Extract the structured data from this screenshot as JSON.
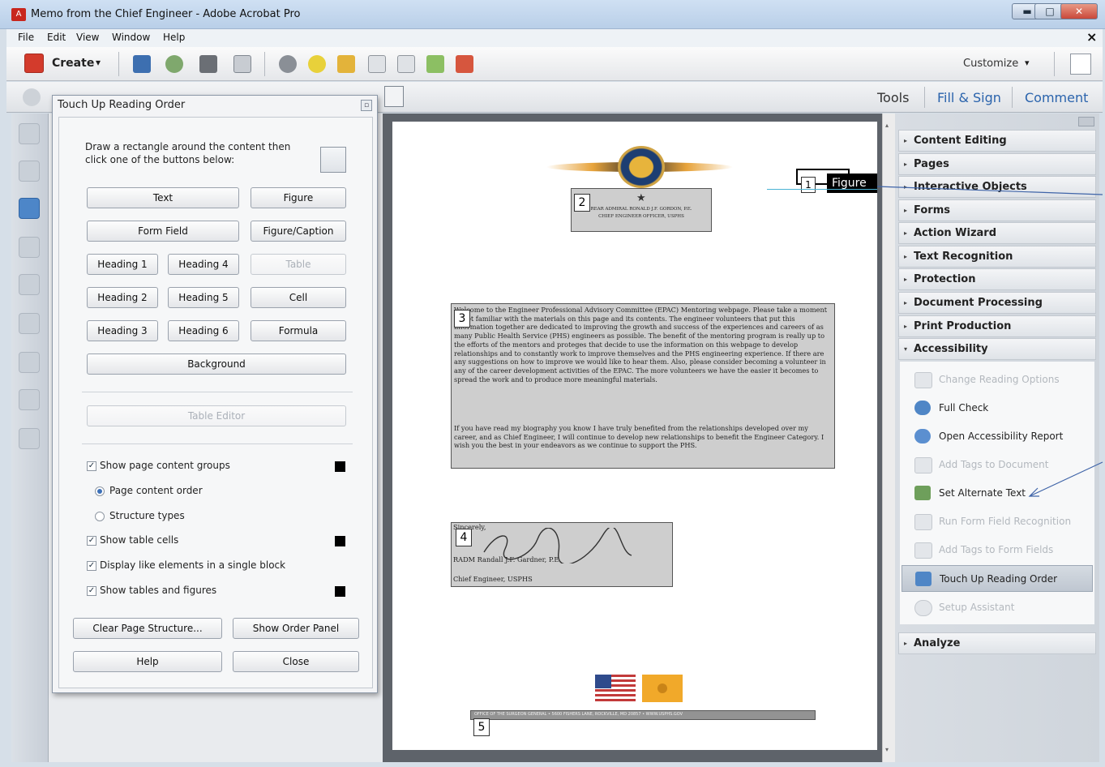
{
  "window": {
    "title": "Memo from the Chief Engineer - Adobe Acrobat Pro",
    "minimize": "▬",
    "maximize": "□",
    "close": "✕"
  },
  "menubar": {
    "items": [
      "File",
      "Edit",
      "View",
      "Window",
      "Help"
    ],
    "close_doc": "×"
  },
  "toolbar": {
    "create_label": "Create",
    "customize_label": "Customize",
    "dropdown_arrow": "▾"
  },
  "tabs": {
    "tools": "Tools",
    "fill_sign": "Fill & Sign",
    "comment": "Comment"
  },
  "dialog": {
    "title": "Touch Up Reading Order",
    "instructions": "Draw a rectangle around the content then click one of the buttons below:",
    "buttons": {
      "text": "Text",
      "figure": "Figure",
      "form_field": "Form Field",
      "figure_caption": "Figure/Caption",
      "heading1": "Heading 1",
      "heading4": "Heading 4",
      "table": "Table",
      "heading2": "Heading 2",
      "heading5": "Heading 5",
      "cell": "Cell",
      "heading3": "Heading 3",
      "heading6": "Heading 6",
      "formula": "Formula",
      "background": "Background",
      "table_editor": "Table Editor",
      "clear_page_structure": "Clear Page Structure...",
      "show_order_panel": "Show Order Panel",
      "help": "Help",
      "close": "Close"
    },
    "options": {
      "show_page_content_groups": "Show page content groups",
      "page_content_order": "Page content order",
      "structure_types": "Structure types",
      "show_table_cells": "Show table cells",
      "display_like_elements": "Display like elements in a single block",
      "show_tables_and_figures": "Show tables and figures"
    },
    "checkmark": "✓"
  },
  "right_panel": {
    "sections": [
      "Content Editing",
      "Pages",
      "Interactive Objects",
      "Forms",
      "Action Wizard",
      "Text Recognition",
      "Protection",
      "Document Processing",
      "Print Production"
    ],
    "accessibility": {
      "label": "Accessibility",
      "items": [
        {
          "label": "Change Reading Options",
          "enabled": false
        },
        {
          "label": "Full Check",
          "enabled": true
        },
        {
          "label": "Open Accessibility Report",
          "enabled": true
        },
        {
          "label": "Add Tags to Document",
          "enabled": false
        },
        {
          "label": "Set Alternate Text",
          "enabled": true
        },
        {
          "label": "Run Form Field Recognition",
          "enabled": false
        },
        {
          "label": "Add Tags to Form Fields",
          "enabled": false
        },
        {
          "label": "Touch Up Reading Order",
          "enabled": true,
          "selected": true
        },
        {
          "label": "Setup Assistant",
          "enabled": false
        }
      ]
    },
    "analyze": "Analyze",
    "arrow_right": "▸",
    "arrow_down": "▾"
  },
  "document": {
    "figure_label": "Figure",
    "regions": [
      "1",
      "2",
      "3",
      "4",
      "5"
    ],
    "signature_block_header": "REAR ADMIRAL RONALD J.F. GORDON, P.E.",
    "signature_block_sub": "CHIEF ENGINEER OFFICER, USPHS",
    "body_paragraph_1": "Welcome to the Engineer Professional Advisory Committee (EPAC) Mentoring webpage. Please take a moment to get familiar with the materials on this page and its contents. The engineer volunteers that put this information together are dedicated to improving the growth and success of the experiences and careers of as many Public Health Service (PHS) engineers as possible. The benefit of the mentoring program is really up to the efforts of the mentors and proteges that decide to use the information on this webpage to develop relationships and to constantly work to improve themselves and the PHS engineering experience. If there are any suggestions on how to improve we would like to hear them. Also, please consider becoming a volunteer in any of the career development activities of the EPAC. The more volunteers we have the easier it becomes to spread the work and to produce more meaningful materials.",
    "body_paragraph_2": "If you have read my biography you know I have truly benefited from the relationships developed over my career, and as Chief Engineer, I will continue to develop new relationships to benefit the Engineer Category. I wish you the best in your endeavors as we continue to support the PHS.",
    "closing": "Sincerely,",
    "signer": "RADM Randall J.F. Gardner, P.E.",
    "signer_title": "Chief Engineer, USPHS",
    "footer": "OFFICE OF THE SURGEON GENERAL • 5600 FISHERS LANE, ROCKVILLE, MD 20857 • WWW.USPHS.GOV"
  }
}
